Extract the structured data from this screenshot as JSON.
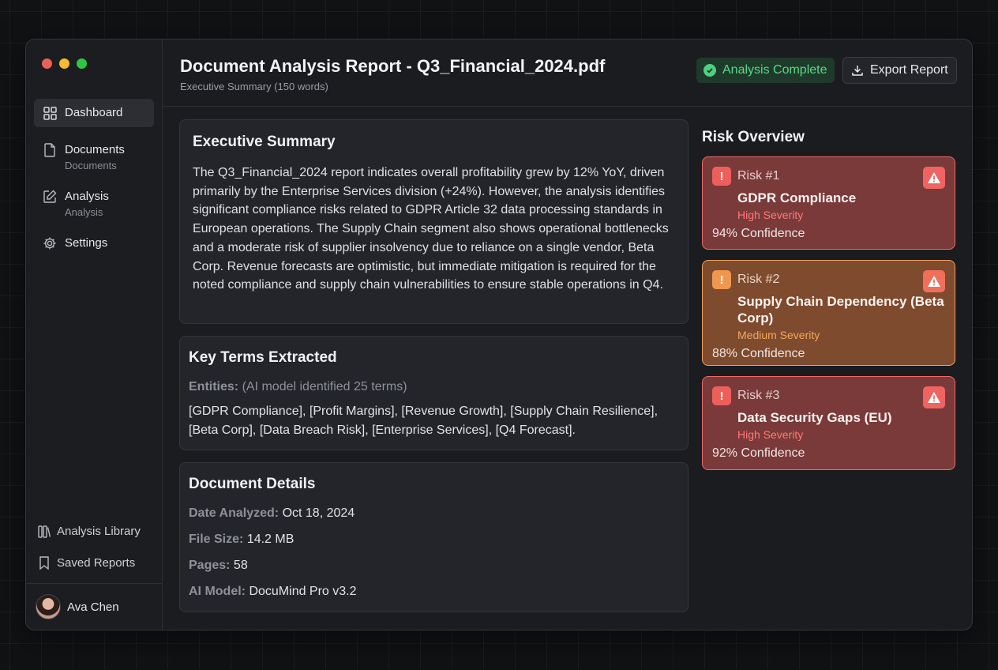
{
  "sidebar": {
    "nav": [
      {
        "label": "Dashboard",
        "sub": "",
        "icon": "dashboard-icon"
      },
      {
        "label": "Documents",
        "sub": "Documents",
        "icon": "document-icon"
      },
      {
        "label": "Analysis",
        "sub": "Analysis",
        "icon": "edit-icon"
      },
      {
        "label": "Settings",
        "sub": "",
        "icon": "gear-icon"
      }
    ],
    "bottom_links": [
      {
        "label": "Analysis Library",
        "icon": "library-icon"
      },
      {
        "label": "Saved Reports",
        "icon": "bookmark-icon"
      }
    ],
    "user": {
      "name": "Ava Chen"
    }
  },
  "header": {
    "title": "Document Analysis Report - Q3_Financial_2024.pdf",
    "subtitle": "Executive Summary (150 words)",
    "status": "Analysis Complete",
    "export_label": "Export Report"
  },
  "summary": {
    "heading": "Executive Summary",
    "text": "The Q3_Financial_2024 report indicates overall profitability grew by 12% YoY, driven primarily by the Enterprise Services division (+24%). However, the analysis identifies significant compliance risks related to GDPR Article 32 data processing standards in European operations. The Supply Chain segment also shows operational bottlenecks and a moderate risk of supplier insolvency due to reliance on a single vendor, Beta Corp. Revenue forecasts are optimistic, but immediate mitigation is required for the noted compliance and supply chain vulnerabilities to ensure stable operations in Q4."
  },
  "terms": {
    "heading": "Key Terms Extracted",
    "entities_label": "Entities:",
    "entities_note": "(AI model identified 25 terms)",
    "list": "[GDPR Compliance], [Profit Margins], [Revenue Growth], [Supply Chain Resilience], [Beta Corp], [Data Breach Risk], [Enterprise Services], [Q4 Forecast]."
  },
  "details": {
    "heading": "Document Details",
    "rows": [
      {
        "key": "Date Analyzed:",
        "value": "Oct 18, 2024"
      },
      {
        "key": "File Size:",
        "value": "14.2 MB"
      },
      {
        "key": "Pages:",
        "value": "58"
      },
      {
        "key": "AI Model:",
        "value": "DocuMind Pro v3.2"
      }
    ]
  },
  "risks": {
    "heading": "Risk Overview",
    "items": [
      {
        "num": "Risk #1",
        "name": "GDPR Compliance",
        "severity": "High Severity",
        "confidence": "94% Confidence"
      },
      {
        "num": "Risk #2",
        "name": "Supply Chain Dependency (Beta Corp)",
        "severity": "Medium Severity",
        "confidence": "88% Confidence"
      },
      {
        "num": "Risk #3",
        "name": "Data Security Gaps (EU)",
        "severity": "High Severity",
        "confidence": "92% Confidence"
      }
    ]
  },
  "colors": {
    "accent_green": "#59d98a",
    "risk_high": "#ee6a66",
    "risk_medium": "#f2a05c"
  }
}
